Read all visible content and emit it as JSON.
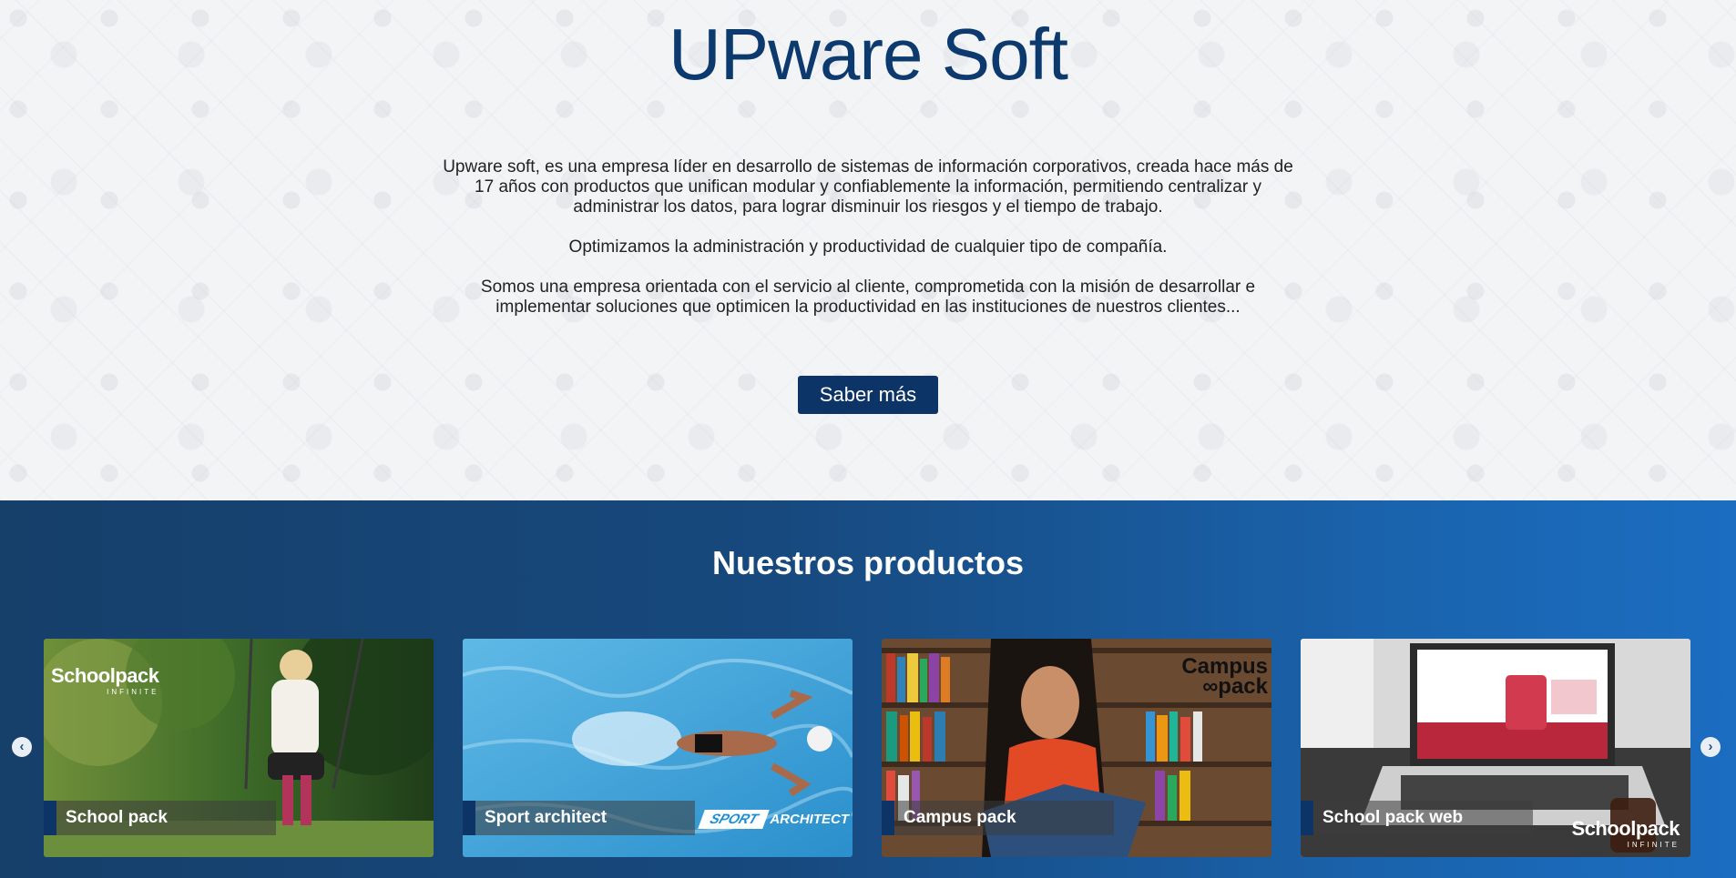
{
  "hero": {
    "title": "UPware Soft",
    "paragraph_1": "Upware soft, es una empresa líder en desarrollo de sistemas de información corporativos, creada hace más de 17 años con productos que unifican modular y confiablemente la información, permitiendo centralizar y administrar los datos, para lograr disminuir los riesgos y el tiempo de trabajo.",
    "paragraph_2": "Optimizamos la administración y productividad de cualquier tipo de compañía.",
    "paragraph_3": "Somos una empresa orientada con el servicio al cliente, comprometida con la misión de desarrollar e implementar soluciones que optimicen la productividad en las instituciones de nuestros clientes...",
    "cta_label": "Saber más"
  },
  "products": {
    "title": "Nuestros productos",
    "items": [
      {
        "label": "School pack",
        "logo": "Schoolpack",
        "logo_sub": "INFINITE"
      },
      {
        "label": "Sport architect",
        "logo_a": "SPORT",
        "logo_b": "ARCHITECT"
      },
      {
        "label": "Campus pack",
        "logo_a": "Campus",
        "logo_b": "∞pack"
      },
      {
        "label": "School pack web",
        "logo": "Schoolpack",
        "logo_sub": "INFINITE"
      }
    ],
    "prev_icon": "chevron-left-icon",
    "next_icon": "chevron-right-icon"
  },
  "colors": {
    "brand_dark": "#0d3467",
    "title_blue": "#0d3a6e",
    "section_gradient_start": "#163f6a",
    "section_gradient_end": "#1b6dc1"
  }
}
